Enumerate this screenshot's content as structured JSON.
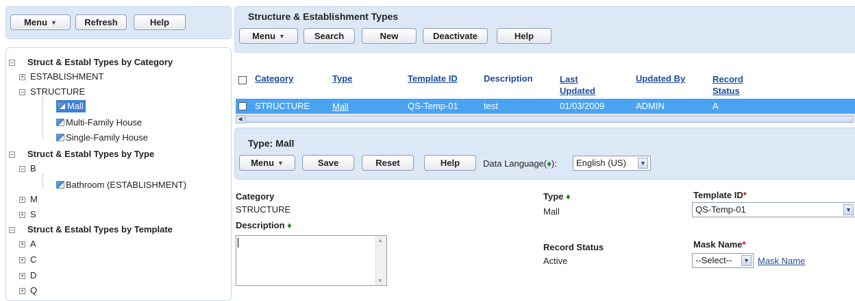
{
  "left_toolbar": {
    "menu": "Menu",
    "refresh": "Refresh",
    "help": "Help"
  },
  "tree": {
    "cat_header": "Struct & Establ Types by Category",
    "establishment": "ESTABLISHMENT",
    "structure": "STRUCTURE",
    "mall": "Mall",
    "multi": "Multi-Family House",
    "single": "Single-Family House",
    "type_header": "Struct & Establ Types by Type",
    "b": "B",
    "bathroom": "Bathroom (ESTABLISHMENT)",
    "m": "M",
    "s": "S",
    "tmpl_header": "Struct & Establ Types by Template",
    "a": "A",
    "c": "C",
    "d": "D",
    "q": "Q"
  },
  "list_panel": {
    "title": "Structure & Establishment Types",
    "menu": "Menu",
    "search": "Search",
    "new": "New",
    "deactivate": "Deactivate",
    "help": "Help"
  },
  "table": {
    "headers": {
      "category": "Category",
      "type": "Type",
      "template_id": "Template ID",
      "description": "Description",
      "last_updated_1": "Last",
      "last_updated_2": "Updated",
      "updated_by": "Updated By",
      "record_status_1": "Record",
      "record_status_2": "Status"
    },
    "row": {
      "category": "STRUCTURE",
      "type": "Mall",
      "template_id": "QS-Temp-01",
      "description": "test",
      "last_updated": "01/03/2009",
      "updated_by": "ADMIN",
      "record_status": "A"
    }
  },
  "detail_panel": {
    "title": "Type: Mall",
    "menu": "Menu",
    "save": "Save",
    "reset": "Reset",
    "help": "Help",
    "data_language_label": "Data Language(",
    "data_language_after": "):",
    "data_language_value": "English (US)"
  },
  "form": {
    "category_label": "Category",
    "category_value": "STRUCTURE",
    "description_label": "Description",
    "type_label": "Type",
    "type_value": "Mall",
    "template_label": "Template ID",
    "template_value": "QS-Temp-01",
    "record_status_label": "Record Status",
    "record_status_value": "Active",
    "mask_label": "Mask Name",
    "mask_value": "--Select--",
    "mask_link": "Mask Name"
  },
  "colors": {
    "panel": "#dde8f6",
    "selected_row": "#4aa3f0",
    "link": "#1a4c99",
    "required": "#cc0000",
    "required_diamond": "#1a8a1a"
  }
}
